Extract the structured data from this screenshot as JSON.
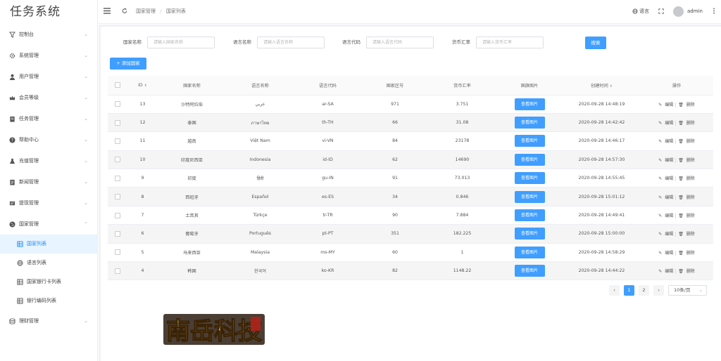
{
  "app": {
    "title": "任务系统"
  },
  "sidebar": {
    "items": [
      {
        "label": "控制台"
      },
      {
        "label": "系统管理"
      },
      {
        "label": "用户管理"
      },
      {
        "label": "会员等级"
      },
      {
        "label": "任务管理"
      },
      {
        "label": "帮助中心"
      },
      {
        "label": "充值管理"
      },
      {
        "label": "新闻管理"
      },
      {
        "label": "提现管理"
      },
      {
        "label": "国家管理"
      },
      {
        "label": "理财管理"
      }
    ],
    "sub_items": [
      {
        "label": "国家列表"
      },
      {
        "label": "语言列表"
      },
      {
        "label": "国家银行卡列表"
      },
      {
        "label": "银行编码列表"
      }
    ]
  },
  "header": {
    "breadcrumb": [
      "国家管理",
      "国家列表"
    ],
    "lang": "语言",
    "user": "admin"
  },
  "filters": {
    "country_name": {
      "label": "国家名称",
      "placeholder": "请输入国家名称"
    },
    "language_name": {
      "label": "语言名称",
      "placeholder": "请输入语言名称"
    },
    "language_code": {
      "label": "语言代码",
      "placeholder": "请输入语言代码"
    },
    "currency_rate": {
      "label": "货币汇率",
      "placeholder": "请输入货币汇率"
    },
    "search_label": "搜索",
    "add_label": "添加国家"
  },
  "table": {
    "columns": [
      "ID",
      "国家名称",
      "语言名称",
      "语言代码",
      "国家区号",
      "货币汇率",
      "国旗图片",
      "创建时间",
      "操作"
    ],
    "image_button": "查看图片",
    "edit_label": "编辑",
    "delete_label": "删除",
    "rows": [
      {
        "id": "13",
        "country": "沙特阿拉伯",
        "language": "عربي",
        "code": "ar-SA",
        "area": "971",
        "rate": "3.751",
        "created": "2020-09-28 14:48:19"
      },
      {
        "id": "12",
        "country": "泰国",
        "language": "ภาษาไทย",
        "code": "th-TH",
        "area": "66",
        "rate": "31.08",
        "created": "2020-09-28 14:42:42"
      },
      {
        "id": "11",
        "country": "越南",
        "language": "Việt Nam",
        "code": "vi-VN",
        "area": "84",
        "rate": "23178",
        "created": "2020-09-28 14:46:17"
      },
      {
        "id": "10",
        "country": "印度尼西亚",
        "language": "Indonesia",
        "code": "id-ID",
        "area": "62",
        "rate": "14690",
        "created": "2020-09-28 14:57:30"
      },
      {
        "id": "9",
        "country": "印度",
        "language": "हिंदी",
        "code": "gu-IN",
        "area": "91",
        "rate": "73.013",
        "created": "2020-09-28 14:55:45"
      },
      {
        "id": "8",
        "country": "西班牙",
        "language": "Español",
        "code": "es-ES",
        "area": "34",
        "rate": "0.846",
        "created": "2020-09-28 15:01:12"
      },
      {
        "id": "7",
        "country": "土耳其",
        "language": "Türkçe",
        "code": "tr-TR",
        "area": "90",
        "rate": "7.884",
        "created": "2020-09-28 14:49:41"
      },
      {
        "id": "6",
        "country": "葡萄牙",
        "language": "Português",
        "code": "pt-PT",
        "area": "351",
        "rate": "182.225",
        "created": "2020-09-28 15:00:00"
      },
      {
        "id": "5",
        "country": "马来西亚",
        "language": "Malaysia",
        "code": "ms-MY",
        "area": "60",
        "rate": "1",
        "created": "2020-09-28 14:58:29"
      },
      {
        "id": "4",
        "country": "韩国",
        "language": "한국어",
        "code": "ko-KR",
        "area": "82",
        "rate": "1148.22",
        "created": "2020-09-28 14:44:22"
      }
    ]
  },
  "pagination": {
    "pages": [
      "1",
      "2"
    ],
    "page_size": "10条/页"
  },
  "watermark": {
    "text": "南岳科技"
  },
  "colors": {
    "primary": "#409eff",
    "active_bg": "#e8f4ff"
  }
}
